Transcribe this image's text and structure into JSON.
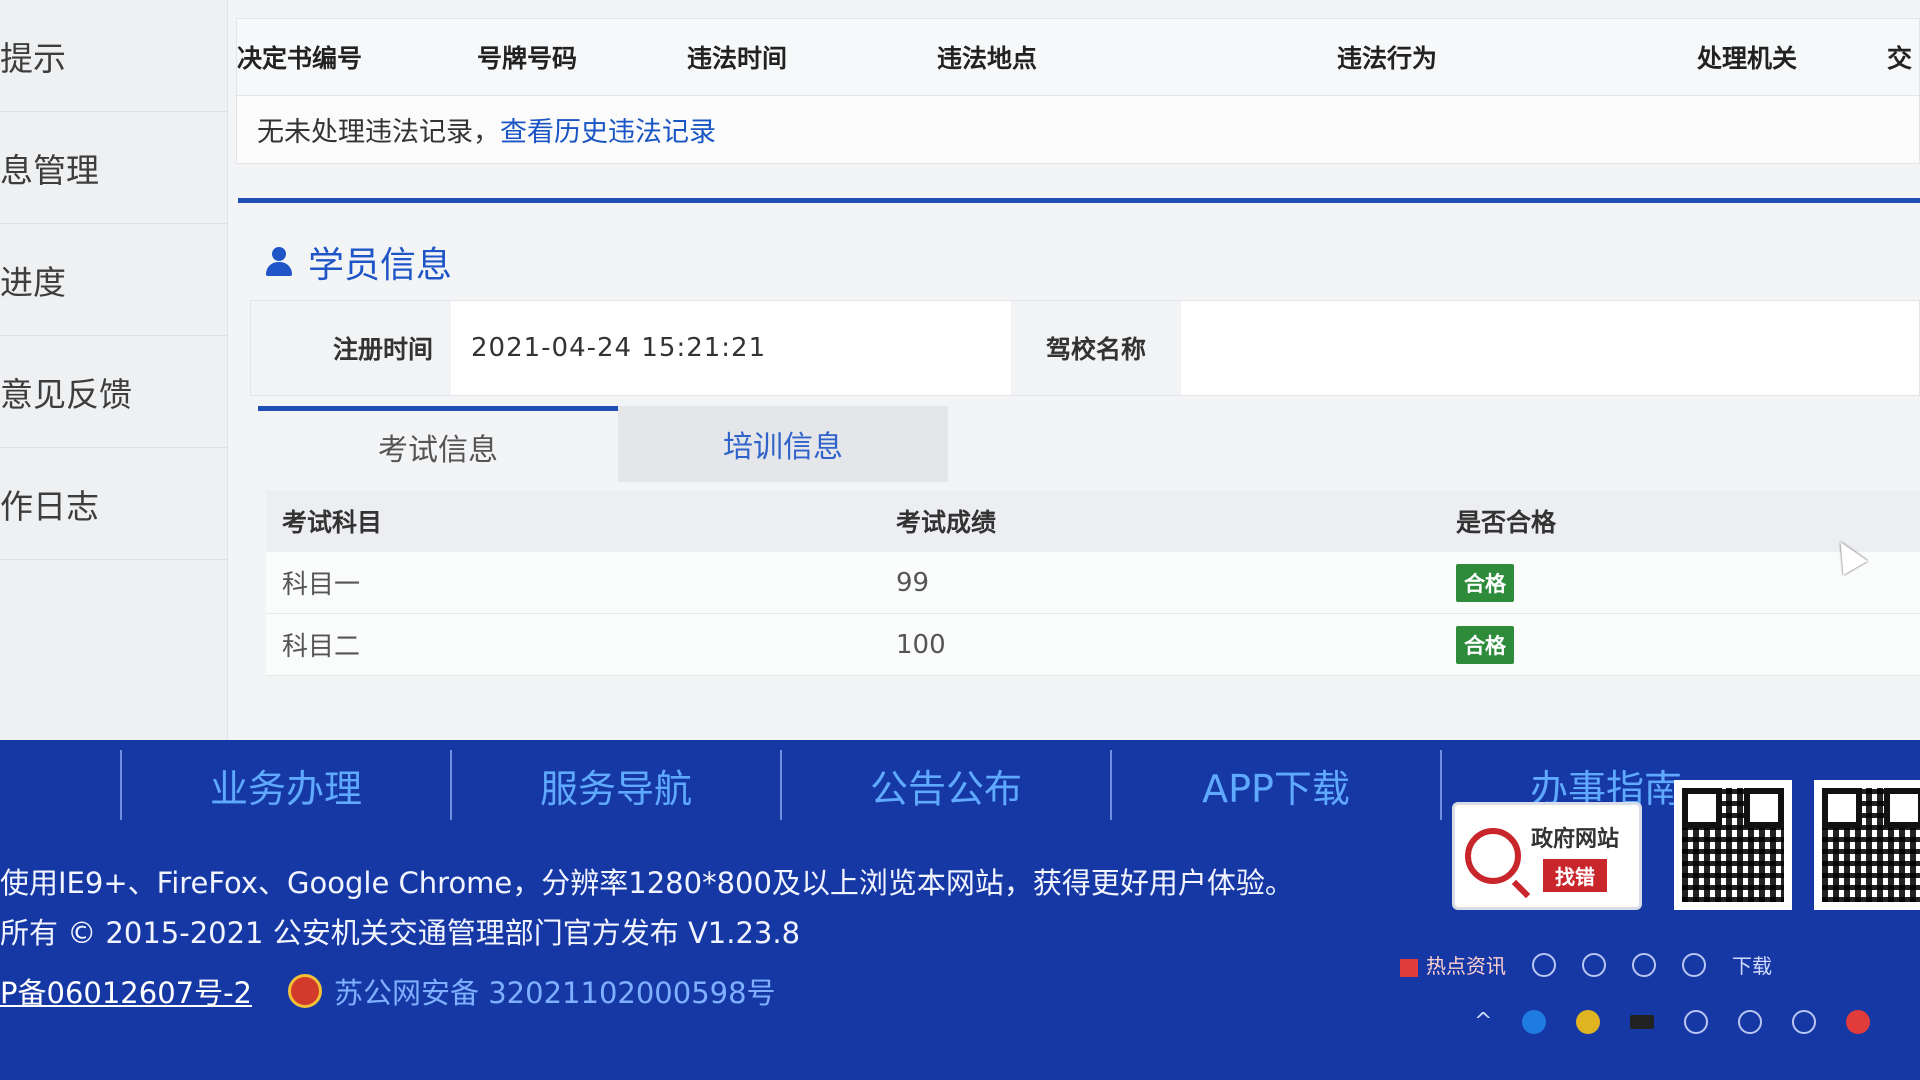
{
  "sidebar": {
    "items": [
      {
        "label": "提示"
      },
      {
        "label": "息管理"
      },
      {
        "label": "进度"
      },
      {
        "label": "意见反馈"
      },
      {
        "label": "作日志"
      }
    ]
  },
  "violations": {
    "headers": [
      "决定书编号",
      "号牌号码",
      "违法时间",
      "违法地点",
      "违法行为",
      "处理机关",
      "交"
    ],
    "empty_text": "无未处理违法记录，",
    "history_link": "查看历史违法记录"
  },
  "student": {
    "title": "学员信息",
    "reg_time_label": "注册时间",
    "reg_time_value": "2021-04-24 15:21:21",
    "school_label": "驾校名称",
    "school_value": ""
  },
  "tabs": [
    {
      "label": "考试信息",
      "active": true
    },
    {
      "label": "培训信息",
      "active": false
    }
  ],
  "exam": {
    "headers": [
      "考试科目",
      "考试成绩",
      "是否合格"
    ],
    "rows": [
      {
        "subject": "科目一",
        "score": "99",
        "status": "合格"
      },
      {
        "subject": "科目二",
        "score": "100",
        "status": "合格"
      }
    ]
  },
  "footer": {
    "nav": [
      "业务办理",
      "服务导航",
      "公告公布",
      "APP下载",
      "办事指南"
    ],
    "browser_note": "使用IE9+、FireFox、Google Chrome，分辨率1280*800及以上浏览本网站，获得更好用户体验。",
    "copyright": "所有 © 2015-2021 公安机关交通管理部门官方发布 V1.23.8",
    "icp": "P备06012607号-2",
    "police_record": "苏公网安备 32021102000598号",
    "gov_box_line1": "政府网站",
    "gov_box_line2": "找错"
  },
  "taskbar": {
    "hot_news": "热点资讯",
    "download": "下载"
  },
  "colors": {
    "accent_blue": "#1f4fb5",
    "footer_blue": "#1638a5",
    "pass_green": "#2e8b3a",
    "link_blue": "#1a55c4"
  }
}
